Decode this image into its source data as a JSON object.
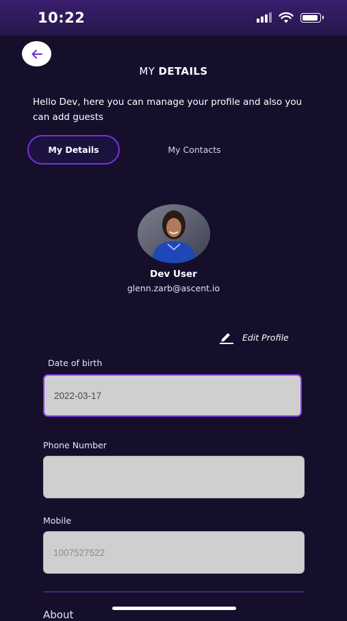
{
  "status_bar": {
    "time": "10:22"
  },
  "header": {
    "title_light": "MY ",
    "title_bold": "DETAILS"
  },
  "intro": {
    "text": "Hello Dev, here you can manage your profile and also you can add guests"
  },
  "tabs": [
    {
      "label": "My Details",
      "active": true
    },
    {
      "label": "My Contacts",
      "active": false
    }
  ],
  "profile": {
    "name": "Dev User",
    "email": "glenn.zarb@ascent.io",
    "edit_label": "Edit Profile"
  },
  "form": {
    "dob": {
      "label": "Date of birth",
      "value": "2022-03-17"
    },
    "phone": {
      "label": "Phone Number",
      "value": ""
    },
    "mobile": {
      "label": "Mobile",
      "placeholder": "1007527522"
    }
  },
  "sections": {
    "about": "About"
  },
  "colors": {
    "background": "#160f2c",
    "accent": "#7a2fe0",
    "field_bg": "#cfcfcf"
  }
}
